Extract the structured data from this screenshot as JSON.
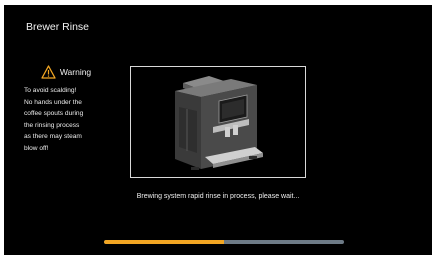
{
  "header": {
    "title": "Brewer Rinse"
  },
  "warning": {
    "icon": "warning-triangle-icon",
    "label": "Warning",
    "lines": [
      "To avoid scalding!",
      "No hands under the",
      "coffee spouts during",
      "the rinsing process",
      "as there may steam",
      "blow off!"
    ]
  },
  "illustration": {
    "icon": "coffee-machine-icon"
  },
  "status": {
    "message": "Brewing system rapid rinse in process, please wait..."
  },
  "progress": {
    "fraction": 0.5,
    "fill_color": "#f2a623",
    "track_color": "#6d7a86"
  }
}
